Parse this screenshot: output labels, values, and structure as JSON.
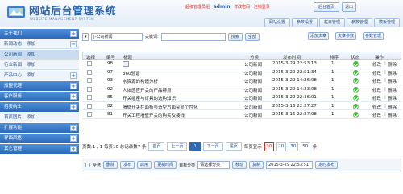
{
  "header": {
    "title": "网站后台管理系统",
    "subtitle": "WEBSITE MANAGEMENT SYSTEM",
    "role": "超级管理员组",
    "username": "admin",
    "change_password": "修改密码",
    "logout": "注销登录",
    "home_btn": "后台首页",
    "exit_btn": "退出"
  },
  "nav_tabs": [
    "网站设置",
    "参数设置",
    "栏目管理",
    "参数管理",
    "模板管理"
  ],
  "sidebar": {
    "add_label": "添加",
    "items": [
      {
        "label": "关于我们",
        "type": "head"
      },
      {
        "label": "新闻动态",
        "type": "sub"
      },
      {
        "label": "公司新闻",
        "type": "sub",
        "active": true
      },
      {
        "label": "行业新闻",
        "type": "sub"
      },
      {
        "label": "产品中心",
        "type": "sub"
      },
      {
        "label": "加盟代理",
        "type": "head"
      },
      {
        "label": "客户服务",
        "type": "head"
      },
      {
        "label": "招贤纳士",
        "type": "head"
      },
      {
        "label": "首页图片",
        "type": "sub"
      },
      {
        "label": "扩展功能",
        "type": "head"
      },
      {
        "label": "界面风格",
        "type": "head"
      },
      {
        "label": "其它管理",
        "type": "head"
      }
    ]
  },
  "toolbar": {
    "category_select": "|-公司新闻",
    "keyword_label": "关键词:",
    "search_btn": "搜索",
    "all_btn": "全部",
    "add_article_btn": "添加文章",
    "add_article_btn2": "文章参数",
    "param_mgr_btn": "参数管理"
  },
  "table": {
    "headers": [
      "选择",
      "编号",
      "标题",
      "分类",
      "发布时间",
      "排序",
      "状态",
      "操作"
    ],
    "edit": "修改",
    "delete": "删除",
    "rows": [
      {
        "id": "98",
        "title": "",
        "category": "公司新闻",
        "time": "2015-3-29 22:53:13",
        "order": "1"
      },
      {
        "id": "97",
        "title": "360验证",
        "category": "公司新闻",
        "time": "2015-3-29 22:51:34",
        "order": "1"
      },
      {
        "id": "93",
        "title": "水资源的构造分析",
        "category": "公司新闻",
        "time": "2015-3-29 14:26:08",
        "order": "1"
      },
      {
        "id": "92",
        "title": "人体感应开关的产品特点",
        "category": "公司新闻",
        "time": "2015-3-29 14:23:08",
        "order": "1"
      },
      {
        "id": "85",
        "title": "开关插座与灯具的选购知识",
        "category": "公司新闻",
        "time": "2015-3-29 22:36:01",
        "order": "1"
      },
      {
        "id": "82",
        "title": "墙壁开关在面板与造型方面突显个性化",
        "category": "公司新闻",
        "time": "2015-3-16 22:27:27",
        "order": "1"
      },
      {
        "id": "81",
        "title": "开关工程墙壁开关的购买及接线",
        "category": "公司新闻",
        "time": "2015-3-16 22:27:08",
        "order": "1"
      }
    ]
  },
  "pager": {
    "summary": "页数:1 / 1 每页10 总记录数7 条",
    "first": "首页",
    "prev": "上一页",
    "page": "1",
    "next": "下一页",
    "last": "尾页",
    "per_page_label": "每页显示",
    "sizes": [
      "10",
      "20",
      "30",
      "50"
    ],
    "unit": "条"
  },
  "bottom": {
    "select_all": "全选",
    "delete": "删除",
    "publish": "发布",
    "enable": "启用",
    "update_time": "更新时间",
    "target_category": "目标分类",
    "select_category": "请选择分类",
    "move": "移动",
    "copy": "复制",
    "time_value": "2015-3-29 22:53:51",
    "timed_publish": "定时发布"
  }
}
